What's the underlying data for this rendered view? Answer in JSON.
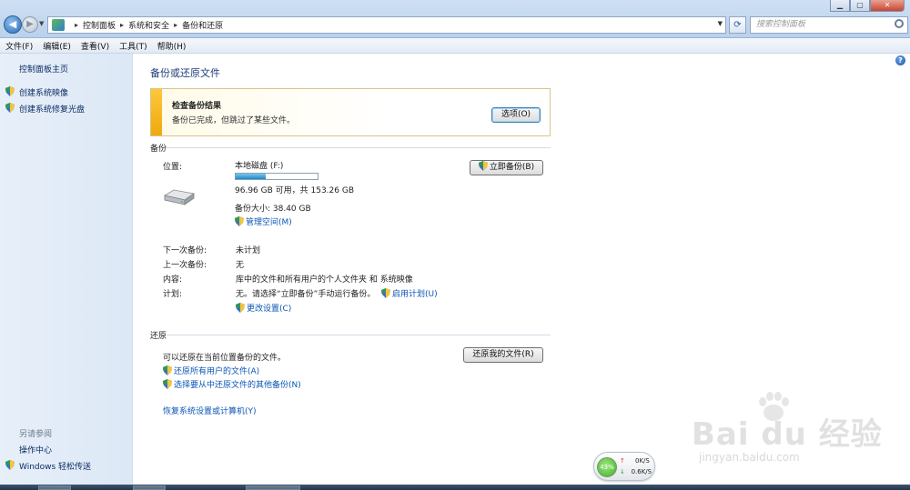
{
  "window": {
    "controls": {
      "minimize": "▁",
      "maximize": "▢",
      "close": "✕"
    }
  },
  "address": {
    "crumbs": [
      "控制面板",
      "系统和安全",
      "备份和还原"
    ],
    "search_placeholder": "搜索控制面板"
  },
  "menu": [
    "文件(F)",
    "编辑(E)",
    "查看(V)",
    "工具(T)",
    "帮助(H)"
  ],
  "sidebar": {
    "home": "控制面板主页",
    "tasks": [
      "创建系统映像",
      "创建系统修复光盘"
    ],
    "see_also_heading": "另请参阅",
    "see_also": [
      "操作中心",
      "Windows 轻松传送"
    ]
  },
  "main": {
    "title": "备份或还原文件",
    "alert": {
      "title": "检查备份结果",
      "message": "备份已完成，但跳过了某些文件。",
      "options_button": "选项(O)"
    },
    "backup": {
      "heading": "备份",
      "location_label": "位置:",
      "location_value": "本地磁盘 (F:)",
      "disk_usage_fraction": 0.37,
      "space_text": "96.96 GB 可用，共 153.26 GB",
      "backup_size": "备份大小: 38.40 GB",
      "manage_space": "管理空间(M)",
      "backup_now_button": "立即备份(B)",
      "next_label": "下一次备份:",
      "next_value": "未计划",
      "last_label": "上一次备份:",
      "last_value": "无",
      "content_label": "内容:",
      "content_value": "库中的文件和所有用户的个人文件夹 和 系统映像",
      "schedule_label": "计划:",
      "schedule_value": "无。请选择“立即备份”手动运行备份。",
      "enable_schedule": "启用计划(U)",
      "change_settings": "更改设置(C)"
    },
    "restore": {
      "heading": "还原",
      "description": "可以还原在当前位置备份的文件。",
      "restore_my_files_button": "还原我的文件(R)",
      "restore_all_users": "还原所有用户的文件(A)",
      "choose_other_backup": "选择要从中还原文件的其他备份(N)",
      "recover_system": "恢复系统设置或计算机(Y)"
    }
  },
  "network_widget": {
    "percent": "43%",
    "up": "0K/S",
    "down": "0.6K/S"
  },
  "watermark": {
    "brand": "Bai du 经验",
    "sub": "jingyan.baidu.com"
  }
}
